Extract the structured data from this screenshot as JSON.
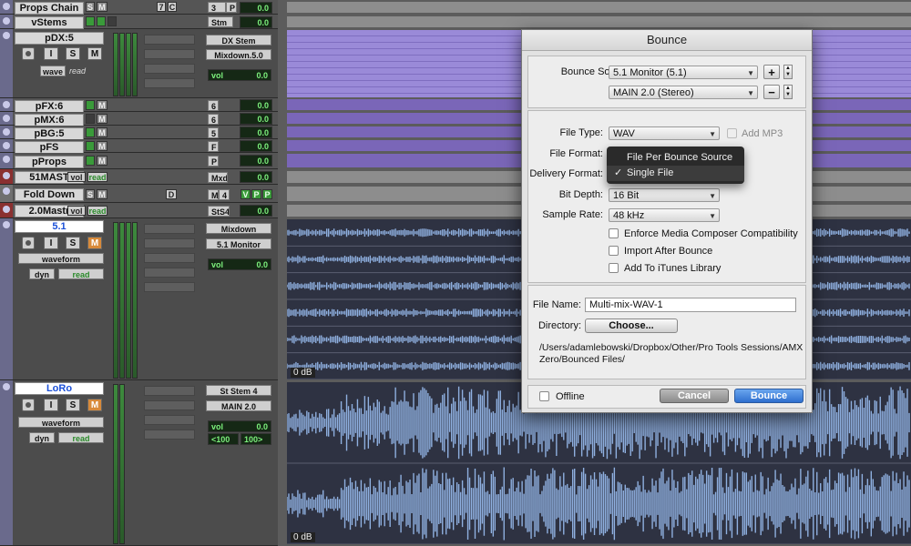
{
  "tracks": {
    "props_chain": {
      "name": "Props Chain",
      "s": "S",
      "m": "M",
      "io": "7",
      "c": "C",
      "num": "3",
      "p": "P",
      "vol": "0.0"
    },
    "vstems": {
      "name": "vStems",
      "io": "Stm",
      "vol": "0.0"
    },
    "pdx": {
      "name": "pDX:5",
      "io_top": "DX Stem",
      "io_bottom": "Mixdown.5.0",
      "s": "S",
      "m": "M",
      "i": "I",
      "auto": "wave",
      "mode": "read",
      "vol_label": "vol",
      "vol": "0.0"
    },
    "small": [
      {
        "name": "pFX:6",
        "num": "6",
        "m": "M",
        "vol": "0.0"
      },
      {
        "name": "pMX:6",
        "num": "6",
        "m": "M",
        "vol": "0.0"
      },
      {
        "name": "pBG:5",
        "num": "5",
        "m": "M",
        "vol": "0.0"
      },
      {
        "name": "pFS",
        "num": "F",
        "m": "M",
        "vol": "0.0"
      },
      {
        "name": "pProps",
        "num": "P",
        "m": "M",
        "vol": "0.0"
      }
    ],
    "mast51": {
      "name": "51MAST",
      "vol_label": "vol",
      "mode": "read",
      "io": "Mxd",
      "vol": "0.0"
    },
    "folddown": {
      "name": "Fold Down",
      "s": "S",
      "m": "M",
      "d": "D",
      "num": "M",
      "n4": "4",
      "v": "V",
      "p1": "P",
      "p2": "P"
    },
    "mastr20": {
      "name": "2.0Mastr",
      "vol_label": "vol",
      "mode": "read",
      "io": "StS4",
      "vol": "0.0"
    },
    "t51": {
      "name": "5.1",
      "io_top": "Mixdown",
      "io_bottom": "5.1 Monitor",
      "i": "I",
      "s": "S",
      "m": "M",
      "auto": "waveform",
      "mode": "read",
      "dyn": "dyn",
      "vol_label": "vol",
      "vol": "0.0",
      "db": "0 dB"
    },
    "loro": {
      "name": "LoRo",
      "io_top": "St Stem 4",
      "io_bottom": "MAIN 2.0",
      "i": "I",
      "s": "S",
      "m": "M",
      "auto": "waveform",
      "mode": "read",
      "dyn": "dyn",
      "vol_label": "vol",
      "vol": "0.0",
      "pan_l": "<100",
      "pan_r": "100>",
      "db": "0 dB"
    }
  },
  "dialog": {
    "title": "Bounce",
    "bounce_source_label": "Bounce Source:",
    "bounce_source_1": "5.1 Monitor (5.1)",
    "bounce_source_2": "MAIN 2.0 (Stereo)",
    "plus": "+",
    "minus": "−",
    "file_type_label": "File Type:",
    "file_type": "WAV",
    "add_mp3": "Add MP3",
    "file_format_label": "File Format:",
    "delivery_format_label": "Delivery Format:",
    "bit_depth_label": "Bit Depth:",
    "bit_depth": "16 Bit",
    "sample_rate_label": "Sample Rate:",
    "sample_rate": "48 kHz",
    "enforce": "Enforce Media Composer Compatibility",
    "import_after": "Import After Bounce",
    "add_itunes": "Add To iTunes Library",
    "file_name_label": "File Name:",
    "file_name": "Multi-mix-WAV-1",
    "directory_label": "Directory:",
    "choose": "Choose...",
    "path": "/Users/adamlebowski/Dropbox/Other/Pro Tools Sessions/AMX Zero/Bounced Files/",
    "offline": "Offline",
    "cancel": "Cancel",
    "bounce": "Bounce"
  },
  "menu": {
    "items": [
      "File Per Bounce Source",
      "Single File"
    ],
    "checked": "✓"
  },
  "icons": {
    "check": "check-icon",
    "caret": "caret-down-icon"
  },
  "colors": {
    "wave_bg": "#2e3242",
    "wave_fg": "#8fb0e0",
    "region_purple": "#9a8ad8",
    "accent_blue": "#2f6fcf"
  }
}
